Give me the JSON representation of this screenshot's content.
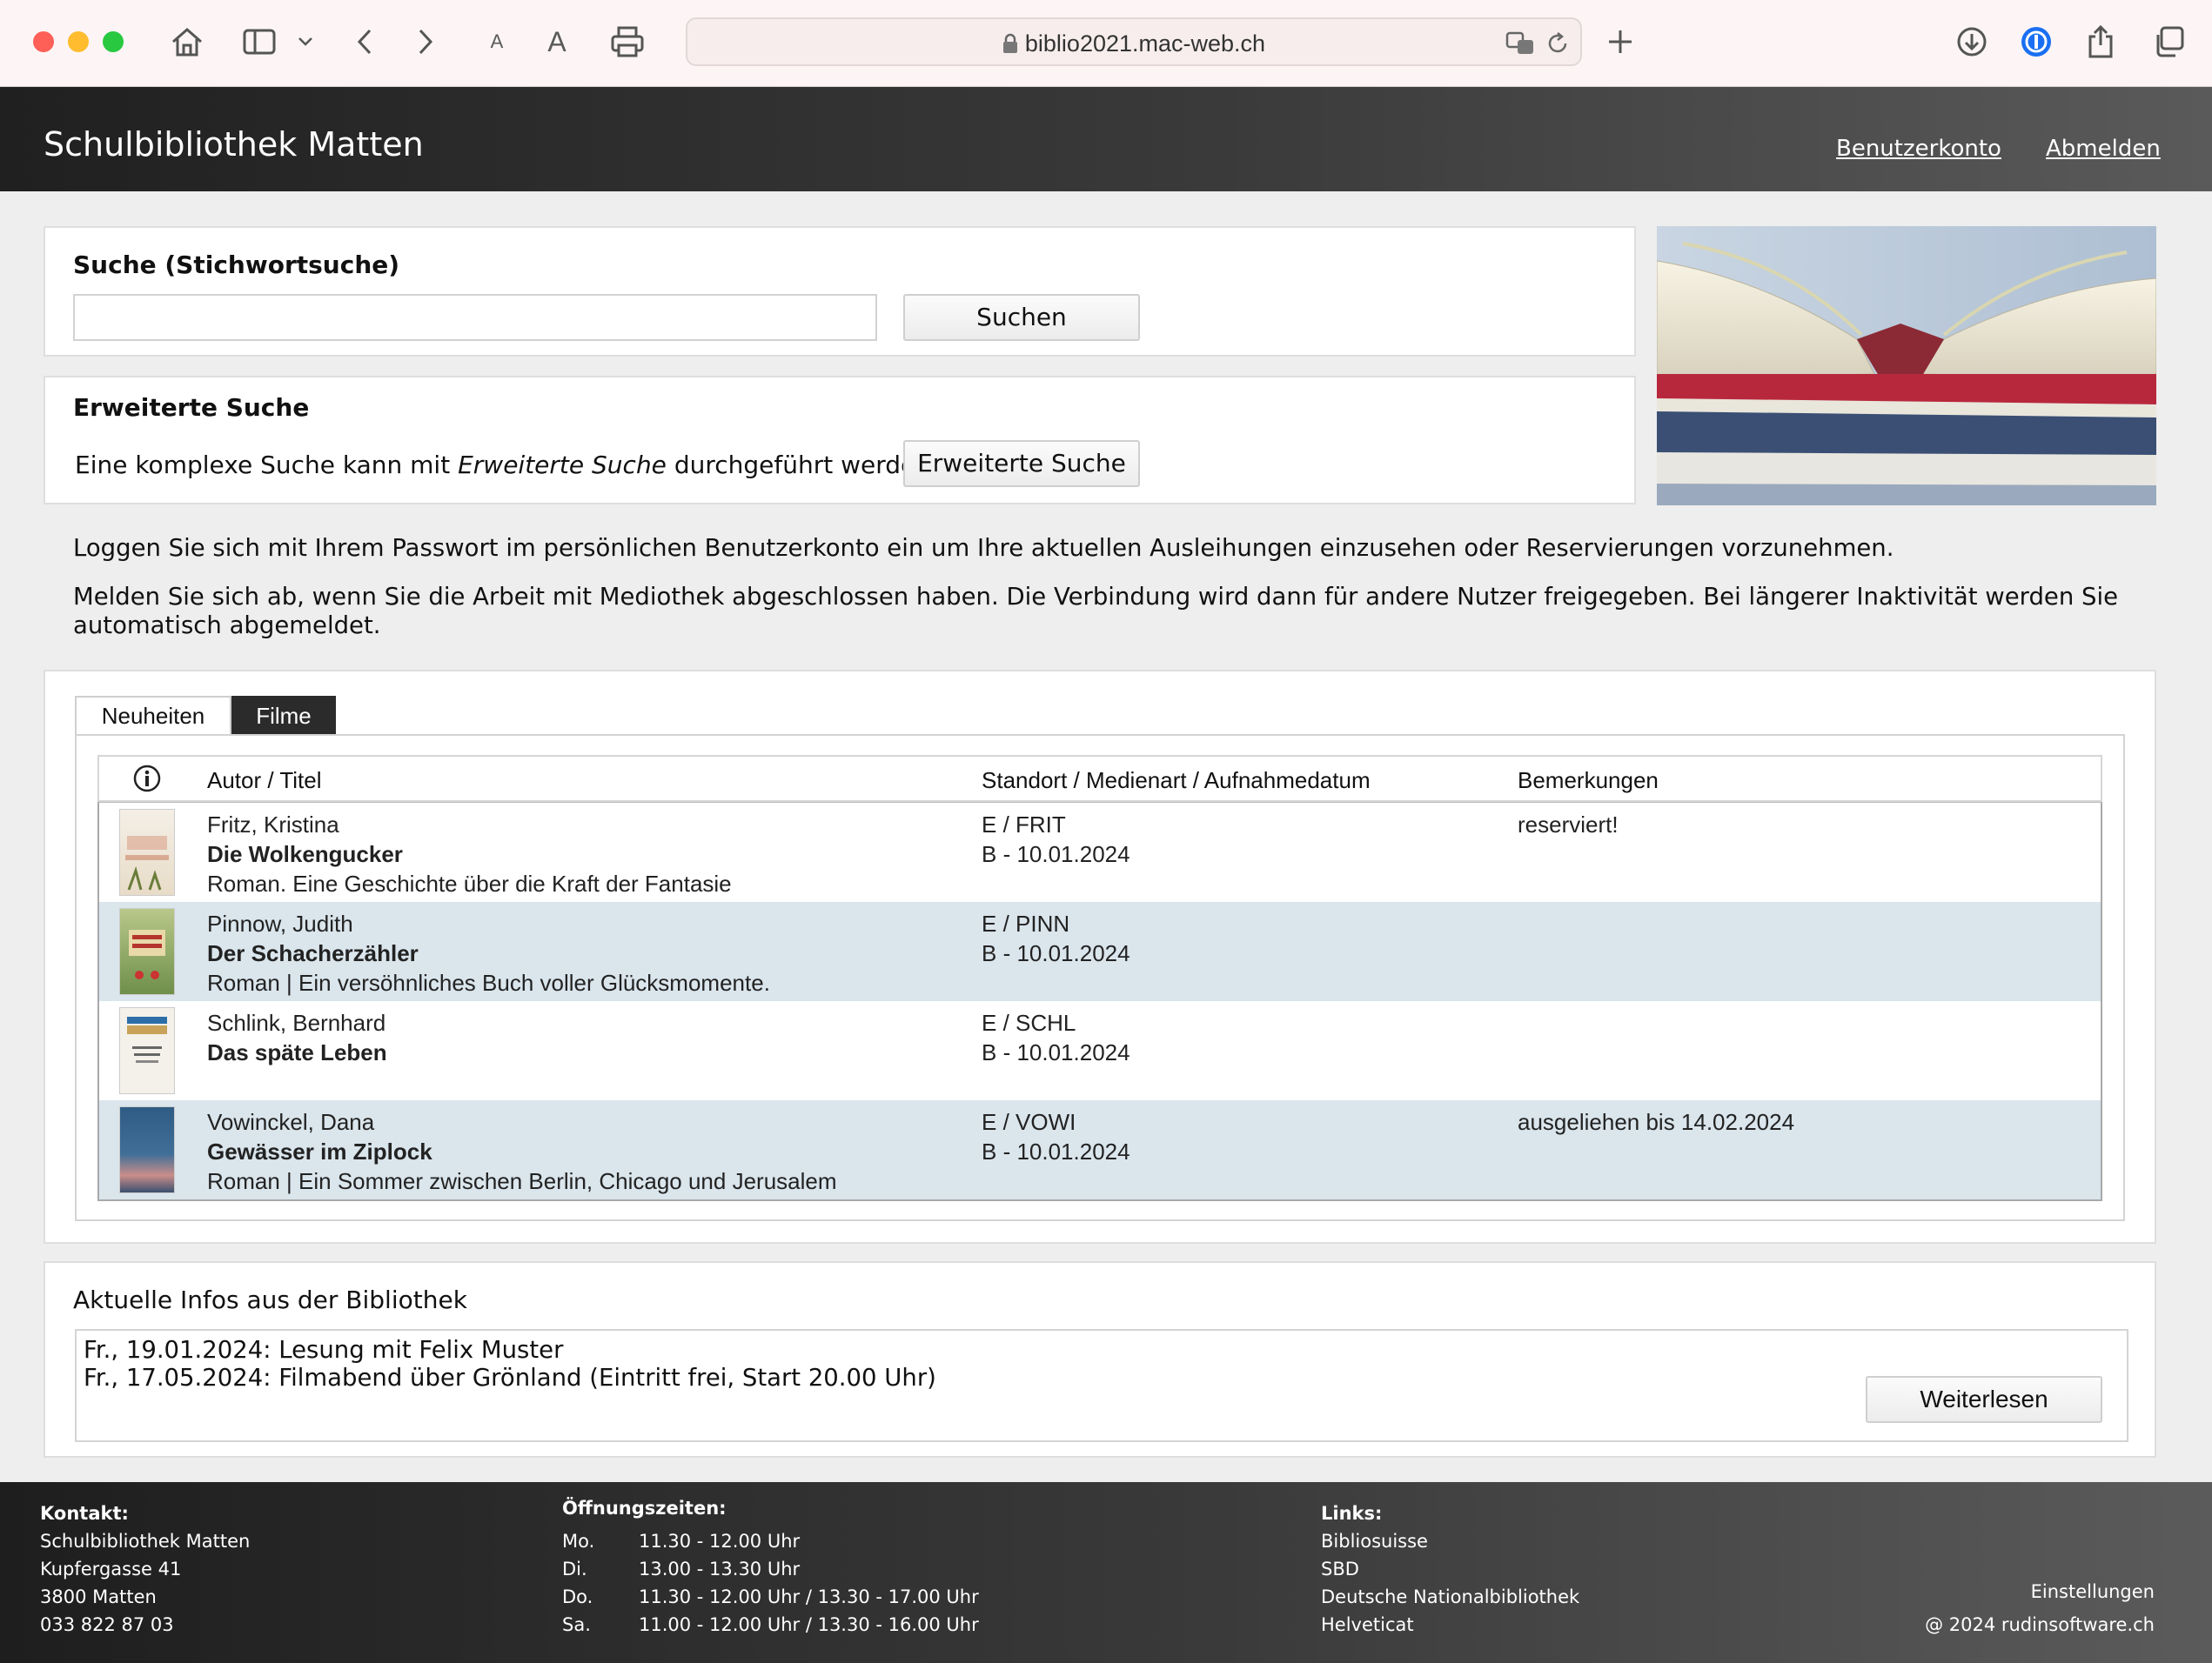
{
  "browser": {
    "url": "biblio2021.mac-web.ch",
    "text_small": "A",
    "text_large": "A"
  },
  "header": {
    "title": "Schulbibliothek Matten",
    "account_link": "Benutzerkonto",
    "logout_link": "Abmelden"
  },
  "search": {
    "title": "Suche (Stichwortsuche)",
    "input_value": "",
    "button": "Suchen"
  },
  "advanced": {
    "title": "Erweiterte Suche",
    "text_before": "Eine komplexe Suche kann mit ",
    "text_em": "Erweiterte Suche",
    "text_after": " durchgeführt werden.",
    "button": "Erweiterte Suche"
  },
  "info": {
    "p1": "Loggen Sie sich mit Ihrem Passwort im persönlichen Benutzerkonto ein um Ihre aktuellen Ausleihungen einzusehen oder Reservierungen vorzunehmen.",
    "p2_line1": "Melden Sie sich ab, wenn Sie die Arbeit mit Mediothek abgeschlossen haben. Die Verbindung wird dann für andere Nutzer freigegeben. Bei längerer Inaktivität werden Sie",
    "p2_line2": "automatisch abgemeldet."
  },
  "tabs": [
    {
      "label": "Neuheiten",
      "active": false
    },
    {
      "label": "Filme",
      "active": true
    }
  ],
  "table": {
    "headers": {
      "col1": "Autor / Titel",
      "col2": "Standort / Medienart / Aufnahmedatum",
      "col3": "Bemerkungen"
    },
    "rows": [
      {
        "author": "Fritz, Kristina",
        "title": "Die Wolkengucker",
        "desc": "Roman. Eine Geschichte über die Kraft der Fantasie",
        "loc": "E / FRIT",
        "date": "B - 10.01.2024",
        "note": "reserviert!"
      },
      {
        "author": "Pinnow, Judith",
        "title": "Der Schacherzähler",
        "desc": "Roman | Ein versöhnliches Buch voller Glücksmomente.",
        "loc": "E / PINN",
        "date": "B - 10.01.2024",
        "note": ""
      },
      {
        "author": "Schlink, Bernhard",
        "title": "Das späte Leben",
        "desc": "",
        "loc": "E / SCHL",
        "date": "B - 10.01.2024",
        "note": ""
      },
      {
        "author": "Vowinckel, Dana",
        "title": "Gewässer im Ziplock",
        "desc": "Roman | Ein Sommer zwischen Berlin, Chicago und Jerusalem",
        "loc": "E / VOWI",
        "date": "B - 10.01.2024",
        "note": "ausgeliehen bis 14.02.2024"
      }
    ]
  },
  "news": {
    "title": "Aktuelle Infos aus der Bibliothek",
    "items": [
      "Fr., 19.01.2024: Lesung mit Felix Muster",
      "Fr., 17.05.2024: Filmabend über Grönland (Eintritt frei, Start 20.00 Uhr)"
    ],
    "button": "Weiterlesen"
  },
  "footer": {
    "contact_label": "Kontakt:",
    "contact": [
      "Schulbibliothek Matten",
      "Kupfergasse 41",
      "3800 Matten",
      "033 822 87 03"
    ],
    "hours_label": "Öffnungszeiten:",
    "hours": [
      {
        "day": "Mo.",
        "time": "11.30 - 12.00 Uhr"
      },
      {
        "day": "Di.",
        "time": "13.00 - 13.30 Uhr"
      },
      {
        "day": "Do.",
        "time": "11.30 - 12.00 Uhr / 13.30 - 17.00 Uhr"
      },
      {
        "day": "Sa.",
        "time": "11.00 - 12.00 Uhr / 13.30 - 16.00 Uhr"
      }
    ],
    "links_label": "Links:",
    "links": [
      "Bibliosuisse",
      "SBD",
      "Deutsche Nationalbibliothek",
      "Helveticat"
    ],
    "settings": "Einstellungen",
    "copyright": "@ 2024 rudinsoftware.ch"
  },
  "colors": {
    "tab_active_bg": "#2b2b2b",
    "row_alt_bg": "#dae5ec",
    "close": "#fe5f57",
    "minimize": "#febc2e",
    "maximize": "#28c840"
  }
}
